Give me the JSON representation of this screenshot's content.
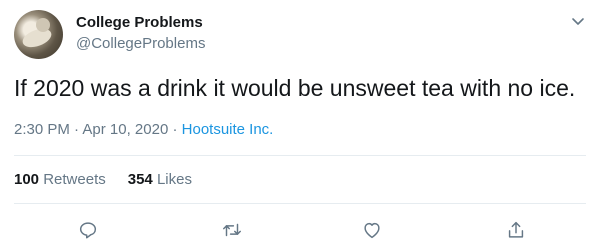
{
  "tweet": {
    "author_name": "College Problems",
    "author_handle": "@CollegeProblems",
    "text": "If 2020 was a drink it would be unsweet tea with no ice.",
    "time": "2:30 PM",
    "date": "Apr 10, 2020",
    "separator": "·",
    "source": "Hootsuite Inc.",
    "retweets_count": "100",
    "retweets_label": "Retweets",
    "likes_count": "354",
    "likes_label": "Likes"
  },
  "colors": {
    "text": "#14171a",
    "secondary": "#657786",
    "link": "#1b95e0",
    "divider": "#e6ecf0"
  },
  "icons": {
    "menu": "chevron-down-icon",
    "reply": "reply-icon",
    "retweet": "retweet-icon",
    "like": "heart-icon",
    "share": "share-icon"
  }
}
